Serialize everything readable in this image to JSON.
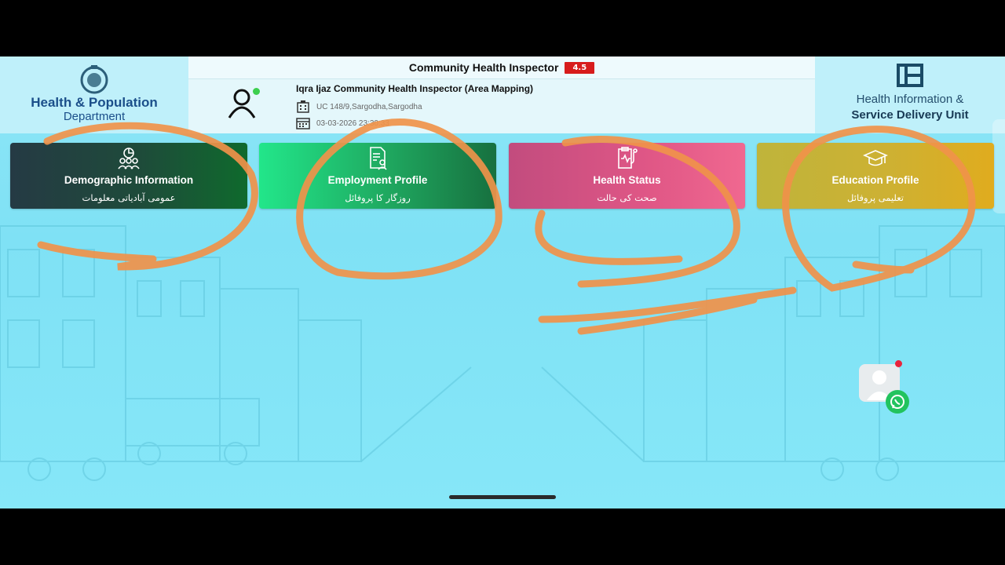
{
  "header": {
    "app_title": "Community Health Inspector",
    "version": "4.5",
    "left_logo": {
      "line1": "Health & Population",
      "line2": "Department"
    },
    "right_logo": {
      "line1": "Health Information &",
      "line2": "Service Delivery Unit"
    }
  },
  "user": {
    "name": "Iqra Ijaz Community Health Inspector (Area Mapping)",
    "location": "UC 148/9,Sargodha,Sargodha",
    "datetime": "03-03-2026 23:30:33",
    "status_color": "#3ccf4e"
  },
  "cards": [
    {
      "icon": "group-pie-icon",
      "title": "Demographic Information",
      "urdu": "عمومی آبادیاتی معلومات"
    },
    {
      "icon": "profile-document-icon",
      "title": "Employment Profile",
      "urdu": "روزگار کا پروفائل"
    },
    {
      "icon": "clipboard-health-icon",
      "title": "Health Status",
      "urdu": "صحت کی حالت"
    },
    {
      "icon": "graduation-cap-icon",
      "title": "Education Profile",
      "urdu": "تعلیمی پروفائل"
    }
  ],
  "colors": {
    "background": "#86e7f8",
    "version_badge": "#d71c1c",
    "annotation": "#f0924a",
    "whatsapp": "#22c35e"
  }
}
